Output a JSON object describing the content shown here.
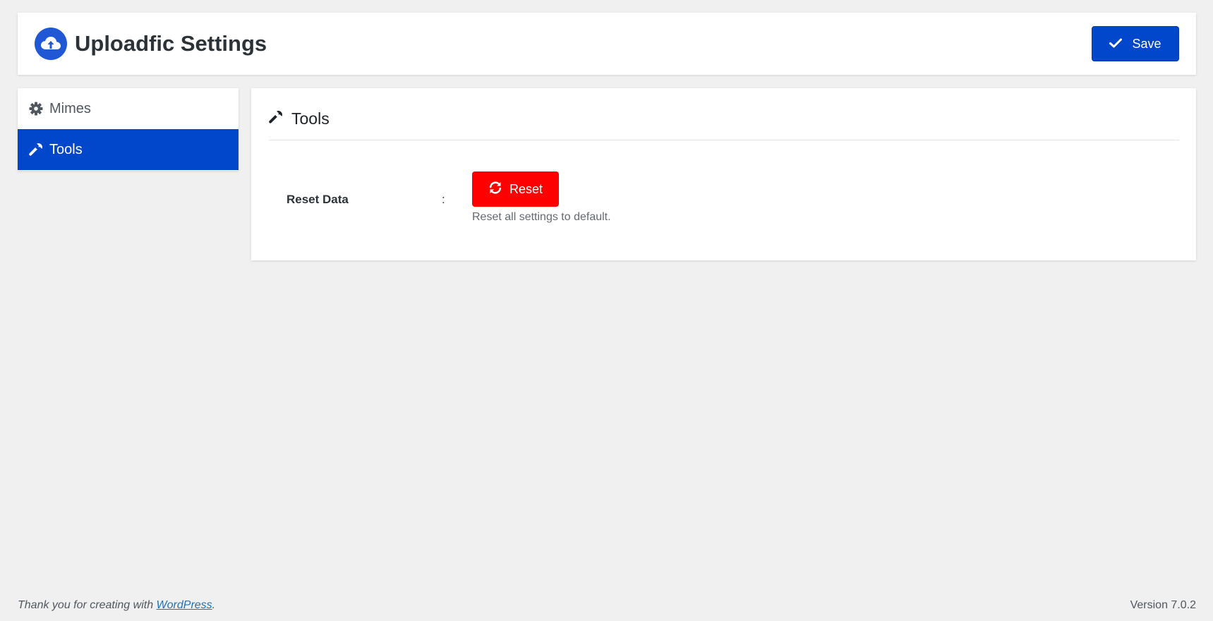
{
  "header": {
    "title": "Uploadfic Settings",
    "logo_icon": "cloud-upload-icon",
    "save_label": "Save",
    "save_icon": "check-icon"
  },
  "sidebar": {
    "items": [
      {
        "label": "Mimes",
        "icon": "gear-icon",
        "active": false
      },
      {
        "label": "Tools",
        "icon": "wrench-icon",
        "active": true
      }
    ]
  },
  "main": {
    "section_title": "Tools",
    "section_icon": "wrench-icon",
    "reset_row": {
      "label": "Reset Data",
      "separator": ":",
      "button_label": "Reset",
      "button_icon": "refresh-icon",
      "description": "Reset all settings to default."
    }
  },
  "footer": {
    "thanks_prefix": "Thank you for creating with",
    "link_text": "WordPress",
    "thanks_suffix": ".",
    "version": "Version 7.0.2"
  },
  "colors": {
    "primary": "#0047cc",
    "danger": "#ff0000",
    "background": "#f0f0f1"
  }
}
